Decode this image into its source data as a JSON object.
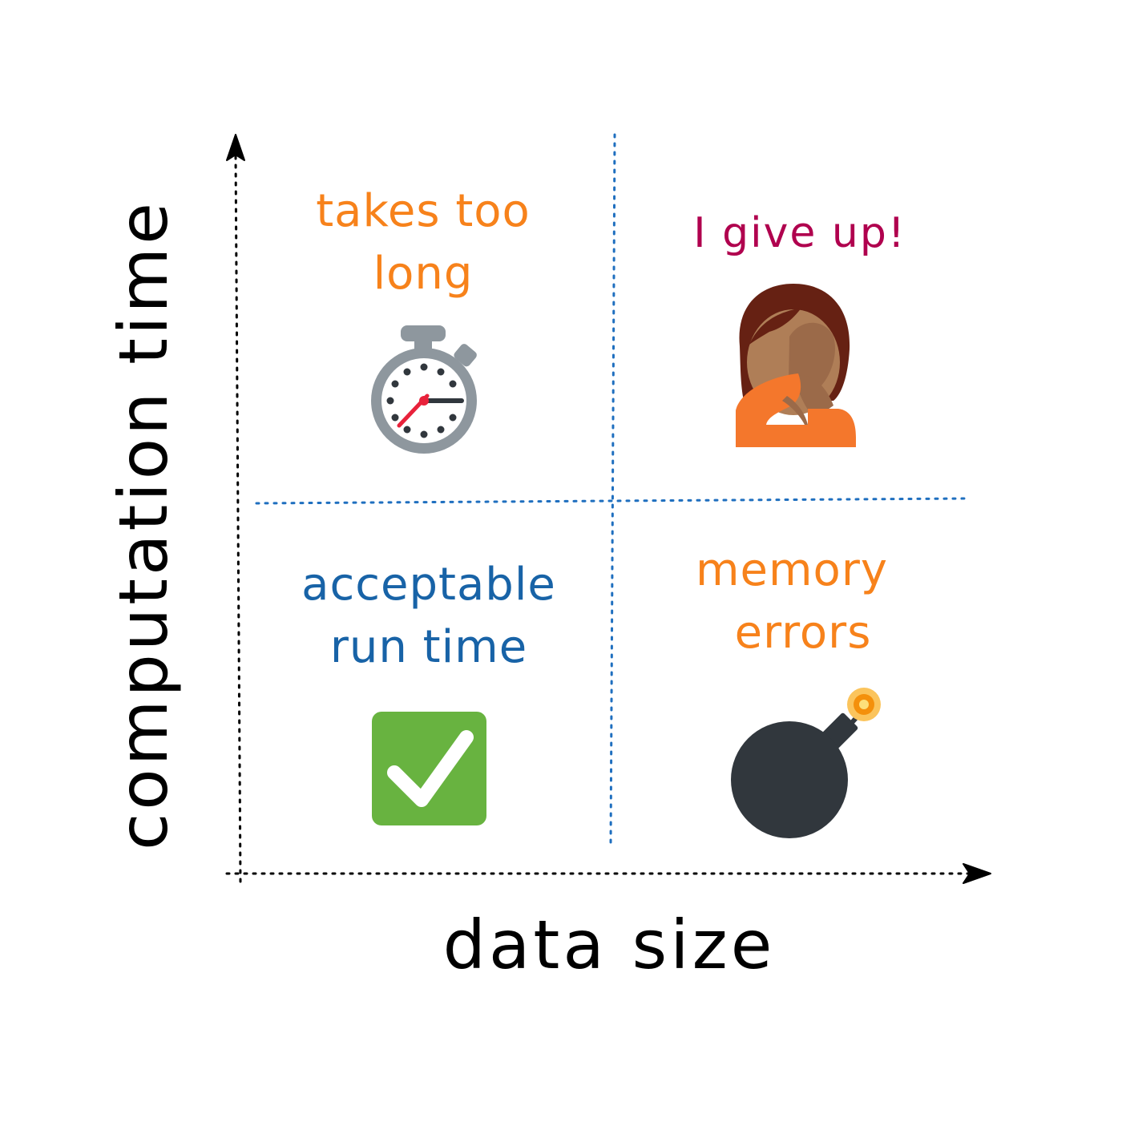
{
  "axes": {
    "x_label": "data size",
    "y_label": "computation time"
  },
  "quadrants": {
    "top_left": {
      "line1": "takes too",
      "line2": "long",
      "icon": "stopwatch-icon",
      "color": "#f7821b"
    },
    "top_right": {
      "line1": "I give up!",
      "icon": "person-facepalming-icon",
      "color": "#b0004e"
    },
    "bottom_left": {
      "line1": "acceptable",
      "line2": "run time",
      "icon": "check-mark-button-icon",
      "color": "#1863a7"
    },
    "bottom_right": {
      "line1": "memory",
      "line2": "errors",
      "icon": "bomb-icon",
      "color": "#f7821b"
    }
  },
  "colors": {
    "divider": "#1f6fbf",
    "axis": "#000000",
    "check_green": "#68b340",
    "bomb": "#31373d"
  }
}
